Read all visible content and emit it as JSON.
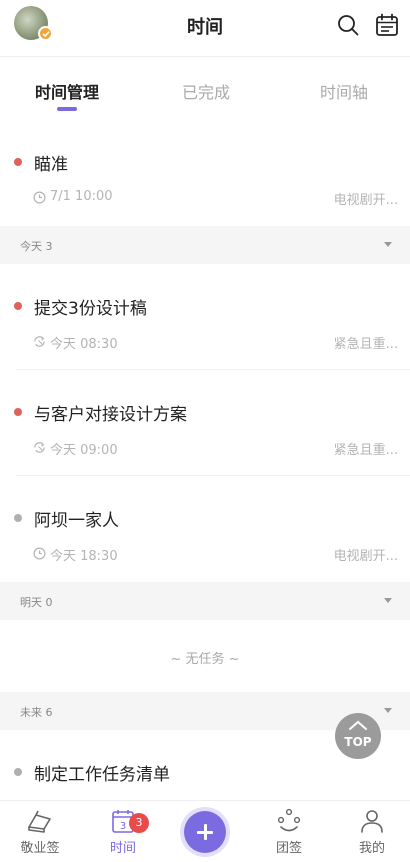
{
  "header": {
    "title": "时间",
    "icons": [
      "avatar",
      "search-icon",
      "calendar-icon"
    ]
  },
  "tabs": [
    {
      "label": "时间管理",
      "active": true
    },
    {
      "label": "已完成",
      "active": false
    },
    {
      "label": "时间轴",
      "active": false
    }
  ],
  "colors": {
    "accent": "#7b6be0",
    "dot_red": "#e0605a",
    "dot_gray": "#b0b0b0",
    "badge": "#e94b4b"
  },
  "items": [
    {
      "title": "瞄准",
      "time": "7/1 10:00",
      "tag": "电视剧开...",
      "dot": "red",
      "icon": "clock-icon"
    },
    {
      "title": "提交3份设计稿",
      "time": "今天 08:30",
      "tag": "紧急且重...",
      "dot": "red",
      "icon": "repeat-icon"
    },
    {
      "title": "与客户对接设计方案",
      "time": "今天 09:00",
      "tag": "紧急且重...",
      "dot": "red",
      "icon": "repeat-icon"
    },
    {
      "title": "阿坝一家人",
      "time": "今天 18:30",
      "tag": "电视剧开...",
      "dot": "gray",
      "icon": "clock-icon"
    },
    {
      "title": "制定工作任务清单",
      "dot": "gray"
    }
  ],
  "sections": {
    "today": "今天 3",
    "tomorrow": "明天 0",
    "future": "未来 6"
  },
  "empty_text": "~ 无任务 ~",
  "top_button": "TOP",
  "bottom_nav": [
    {
      "label": "敬业签",
      "icon": "notebook-icon"
    },
    {
      "label": "时间",
      "icon": "calendar-date-icon",
      "badge": "3",
      "date": "3",
      "active": true
    },
    {
      "label": "团签",
      "icon": "team-icon"
    },
    {
      "label": "我的",
      "icon": "profile-icon"
    }
  ]
}
